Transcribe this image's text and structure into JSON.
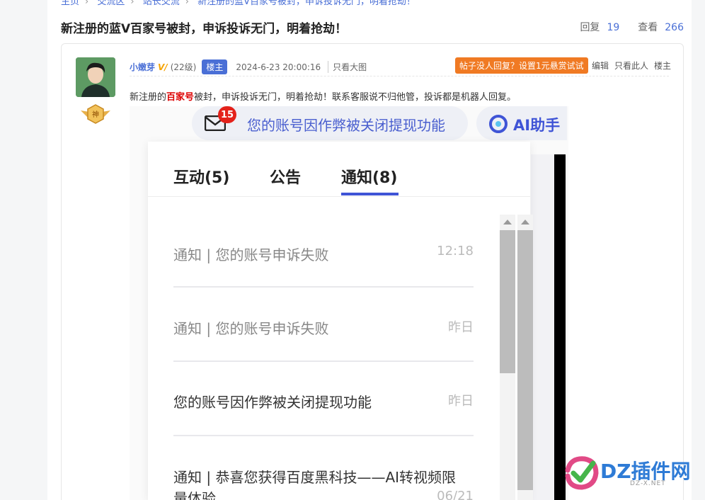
{
  "breadcrumb": [
    "主页",
    "交流区",
    "站长交流",
    "新注册的蓝V百家号被封，申诉投诉无门，明着抢劫！"
  ],
  "thread": {
    "title": "新注册的蓝V百家号被封，申诉投诉无门，明着抢劫！",
    "reply_label": "回复",
    "reply_count": "19",
    "view_label": "查看",
    "view_count": "266"
  },
  "post": {
    "username": "小嫩芽",
    "v_badge": "V/",
    "level": "(22级)",
    "floor_badge": "楼主",
    "date": "2024-6-23 20:00:16",
    "big_image": "只看大图",
    "reward_button": "帖子没人回复？设置1元悬赏试试",
    "actions": [
      "编辑",
      "只看此人",
      "楼主"
    ],
    "medal_text": "神",
    "body_prefix": "新注册的",
    "body_highlight": "百家号",
    "body_suffix": "被封，申诉投诉无门，明着抢劫！联系客服说不归他管，投诉都是机器人回复。"
  },
  "screenshot": {
    "mail_badge": "15",
    "mail_text": "您的账号因作弊被关闭提现功能",
    "ai_text": "AI助手",
    "tabs": [
      "互动(5)",
      "公告",
      "通知(8)"
    ],
    "active_tab": "通知(8)",
    "notices": [
      {
        "title": "通知 | 您的账号申诉失败",
        "time": "12:18",
        "read": true
      },
      {
        "title": "通知 | 您的账号申诉失败",
        "time": "昨日",
        "read": true
      },
      {
        "title": "您的账号因作弊被关闭提现功能",
        "time": "昨日",
        "read": false
      },
      {
        "title": "通知 | 恭喜您获得百度黑科技——AI转视频限",
        "title_line2": "量体验",
        "time": "06/21",
        "read": false
      }
    ]
  },
  "watermark": {
    "text": "DZ插件网",
    "sub": "DZ-X.NET"
  },
  "colors": {
    "link": "#4a6fd6",
    "accent": "#3f54d6",
    "reward": "#f07a23",
    "badge_red": "#e4221b"
  }
}
